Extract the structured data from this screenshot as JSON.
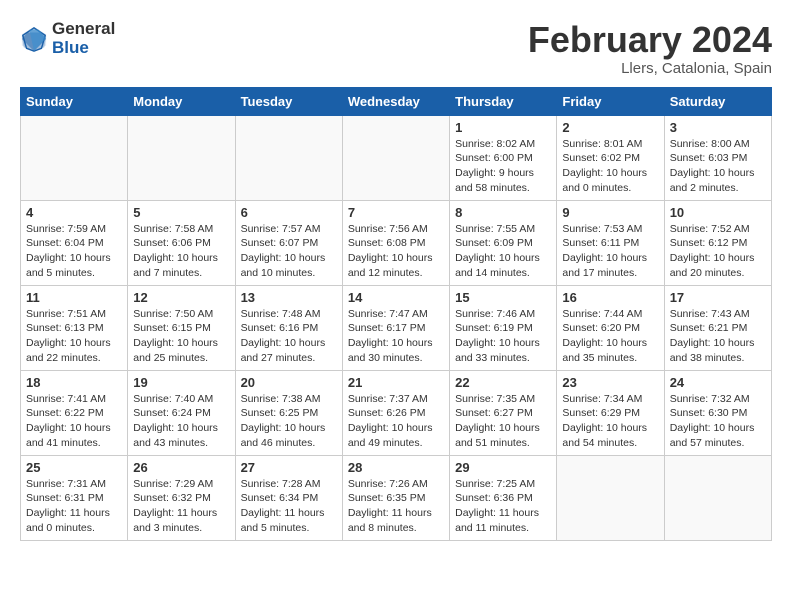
{
  "header": {
    "logo_general": "General",
    "logo_blue": "Blue",
    "month_title": "February 2024",
    "location": "Llers, Catalonia, Spain"
  },
  "days_of_week": [
    "Sunday",
    "Monday",
    "Tuesday",
    "Wednesday",
    "Thursday",
    "Friday",
    "Saturday"
  ],
  "weeks": [
    [
      {
        "day": "",
        "info": ""
      },
      {
        "day": "",
        "info": ""
      },
      {
        "day": "",
        "info": ""
      },
      {
        "day": "",
        "info": ""
      },
      {
        "day": "1",
        "info": "Sunrise: 8:02 AM\nSunset: 6:00 PM\nDaylight: 9 hours\nand 58 minutes."
      },
      {
        "day": "2",
        "info": "Sunrise: 8:01 AM\nSunset: 6:02 PM\nDaylight: 10 hours\nand 0 minutes."
      },
      {
        "day": "3",
        "info": "Sunrise: 8:00 AM\nSunset: 6:03 PM\nDaylight: 10 hours\nand 2 minutes."
      }
    ],
    [
      {
        "day": "4",
        "info": "Sunrise: 7:59 AM\nSunset: 6:04 PM\nDaylight: 10 hours\nand 5 minutes."
      },
      {
        "day": "5",
        "info": "Sunrise: 7:58 AM\nSunset: 6:06 PM\nDaylight: 10 hours\nand 7 minutes."
      },
      {
        "day": "6",
        "info": "Sunrise: 7:57 AM\nSunset: 6:07 PM\nDaylight: 10 hours\nand 10 minutes."
      },
      {
        "day": "7",
        "info": "Sunrise: 7:56 AM\nSunset: 6:08 PM\nDaylight: 10 hours\nand 12 minutes."
      },
      {
        "day": "8",
        "info": "Sunrise: 7:55 AM\nSunset: 6:09 PM\nDaylight: 10 hours\nand 14 minutes."
      },
      {
        "day": "9",
        "info": "Sunrise: 7:53 AM\nSunset: 6:11 PM\nDaylight: 10 hours\nand 17 minutes."
      },
      {
        "day": "10",
        "info": "Sunrise: 7:52 AM\nSunset: 6:12 PM\nDaylight: 10 hours\nand 20 minutes."
      }
    ],
    [
      {
        "day": "11",
        "info": "Sunrise: 7:51 AM\nSunset: 6:13 PM\nDaylight: 10 hours\nand 22 minutes."
      },
      {
        "day": "12",
        "info": "Sunrise: 7:50 AM\nSunset: 6:15 PM\nDaylight: 10 hours\nand 25 minutes."
      },
      {
        "day": "13",
        "info": "Sunrise: 7:48 AM\nSunset: 6:16 PM\nDaylight: 10 hours\nand 27 minutes."
      },
      {
        "day": "14",
        "info": "Sunrise: 7:47 AM\nSunset: 6:17 PM\nDaylight: 10 hours\nand 30 minutes."
      },
      {
        "day": "15",
        "info": "Sunrise: 7:46 AM\nSunset: 6:19 PM\nDaylight: 10 hours\nand 33 minutes."
      },
      {
        "day": "16",
        "info": "Sunrise: 7:44 AM\nSunset: 6:20 PM\nDaylight: 10 hours\nand 35 minutes."
      },
      {
        "day": "17",
        "info": "Sunrise: 7:43 AM\nSunset: 6:21 PM\nDaylight: 10 hours\nand 38 minutes."
      }
    ],
    [
      {
        "day": "18",
        "info": "Sunrise: 7:41 AM\nSunset: 6:22 PM\nDaylight: 10 hours\nand 41 minutes."
      },
      {
        "day": "19",
        "info": "Sunrise: 7:40 AM\nSunset: 6:24 PM\nDaylight: 10 hours\nand 43 minutes."
      },
      {
        "day": "20",
        "info": "Sunrise: 7:38 AM\nSunset: 6:25 PM\nDaylight: 10 hours\nand 46 minutes."
      },
      {
        "day": "21",
        "info": "Sunrise: 7:37 AM\nSunset: 6:26 PM\nDaylight: 10 hours\nand 49 minutes."
      },
      {
        "day": "22",
        "info": "Sunrise: 7:35 AM\nSunset: 6:27 PM\nDaylight: 10 hours\nand 51 minutes."
      },
      {
        "day": "23",
        "info": "Sunrise: 7:34 AM\nSunset: 6:29 PM\nDaylight: 10 hours\nand 54 minutes."
      },
      {
        "day": "24",
        "info": "Sunrise: 7:32 AM\nSunset: 6:30 PM\nDaylight: 10 hours\nand 57 minutes."
      }
    ],
    [
      {
        "day": "25",
        "info": "Sunrise: 7:31 AM\nSunset: 6:31 PM\nDaylight: 11 hours\nand 0 minutes."
      },
      {
        "day": "26",
        "info": "Sunrise: 7:29 AM\nSunset: 6:32 PM\nDaylight: 11 hours\nand 3 minutes."
      },
      {
        "day": "27",
        "info": "Sunrise: 7:28 AM\nSunset: 6:34 PM\nDaylight: 11 hours\nand 5 minutes."
      },
      {
        "day": "28",
        "info": "Sunrise: 7:26 AM\nSunset: 6:35 PM\nDaylight: 11 hours\nand 8 minutes."
      },
      {
        "day": "29",
        "info": "Sunrise: 7:25 AM\nSunset: 6:36 PM\nDaylight: 11 hours\nand 11 minutes."
      },
      {
        "day": "",
        "info": ""
      },
      {
        "day": "",
        "info": ""
      }
    ]
  ]
}
